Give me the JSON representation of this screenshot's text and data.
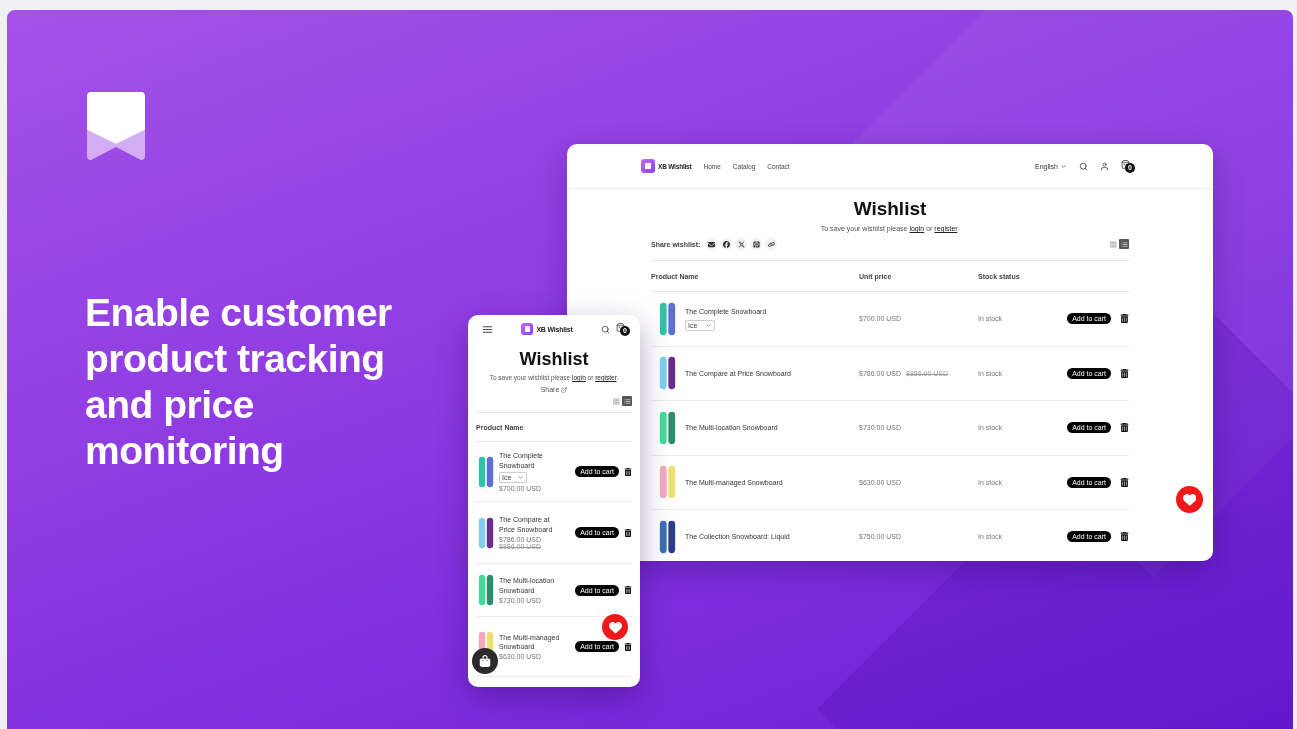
{
  "banner": {
    "headline": "Enable customer product tracking and price monitoring"
  },
  "desktop": {
    "brand": "XB Wishlist",
    "nav": [
      "Home",
      "Catalog",
      "Contact"
    ],
    "language": "English",
    "cart_count": "0",
    "title": "Wishlist",
    "save_prompt": {
      "before": "To save your wishlist please",
      "login": "login",
      "middle": "or",
      "register": "register",
      "after": "."
    },
    "share_label": "Share wishlist:",
    "views": [
      {
        "kind": "grid",
        "selected": false
      },
      {
        "kind": "list",
        "selected": true
      }
    ],
    "columns": [
      "Product Name",
      "Unit price",
      "Stock status"
    ],
    "rows": [
      {
        "name": "The Complete Snowboard",
        "variant": "Ice",
        "price": "$700.00 USD",
        "stock": "In stock",
        "action": "Add to cart"
      },
      {
        "name": "The Compare at Price Snowboard",
        "price": "$786.00 USD",
        "compare_price": "$886.00 USD",
        "stock": "In stock",
        "action": "Add to cart"
      },
      {
        "name": "The Multi-location Snowboard",
        "price": "$730.00 USD",
        "stock": "In stock",
        "action": "Add to cart"
      },
      {
        "name": "The Multi-managed Snowboard",
        "price": "$630.00 USD",
        "stock": "In stock",
        "action": "Add to cart"
      },
      {
        "name": "The Collection Snowboard: Liquid",
        "price": "$750.00 USD",
        "stock": "In stock",
        "action": "Add to cart"
      }
    ]
  },
  "mobile": {
    "brand": "XB Wishlist",
    "cart_count": "0",
    "title": "Wishlist",
    "save_prompt": {
      "before": "To save your wishlist please",
      "login": "login",
      "middle": "or",
      "register": "register",
      "after": "."
    },
    "share_label": "Share",
    "views": [
      {
        "kind": "grid",
        "selected": false
      },
      {
        "kind": "list",
        "selected": true
      }
    ],
    "columns": [
      "Product Name"
    ],
    "rows": [
      {
        "name": "The Complete Snowboard",
        "variant": "Ice",
        "price": "$700.00 USD",
        "action": "Add to cart"
      },
      {
        "name": "The Compare at Price Snowboard",
        "price": "$786.00 USD",
        "compare_price": "$886.00 USD",
        "action": "Add to cart"
      },
      {
        "name": "The Multi-location Snowboard",
        "price": "$730.00 USD",
        "action": "Add to cart"
      },
      {
        "name": "The Multi-managed Snowboard",
        "price": "$630.00 USD",
        "action": "Add to cart"
      }
    ]
  }
}
